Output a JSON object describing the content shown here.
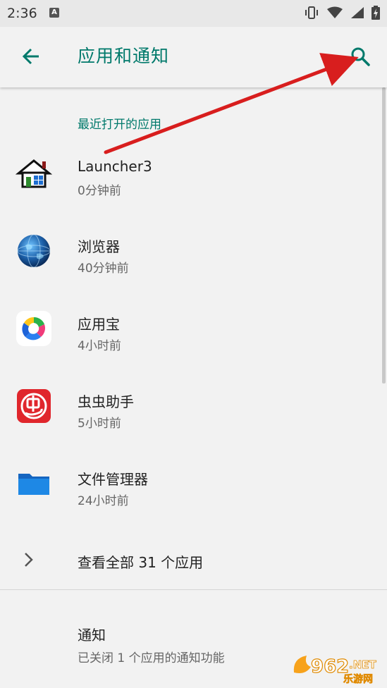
{
  "status_bar": {
    "time": "2:36",
    "notification_badge": "A",
    "icons": [
      "vibrate-icon",
      "wifi-icon",
      "signal-icon",
      "battery-icon"
    ]
  },
  "app_bar": {
    "title": "应用和通知",
    "back_icon": "arrow-left-icon",
    "search_icon": "search-icon"
  },
  "recent": {
    "header": "最近打开的应用",
    "apps": [
      {
        "name": "Launcher3",
        "time": "0分钟前",
        "icon": "launcher3-icon"
      },
      {
        "name": "浏览器",
        "time": "40分钟前",
        "icon": "browser-globe-icon"
      },
      {
        "name": "应用宝",
        "time": "4小时前",
        "icon": "yingyongbao-icon"
      },
      {
        "name": "虫虫助手",
        "time": "5小时前",
        "icon": "chongchong-icon"
      },
      {
        "name": "文件管理器",
        "time": "24小时前",
        "icon": "folder-icon"
      }
    ]
  },
  "view_all": {
    "label": "查看全部 31 个应用",
    "icon": "chevron-right-icon"
  },
  "notifications": {
    "title": "通知",
    "subtitle": "已关闭 1 个应用的通知功能"
  },
  "colors": {
    "accent": "#00796b",
    "background": "#f2f2f2",
    "annotation_arrow": "#d81e1e"
  }
}
